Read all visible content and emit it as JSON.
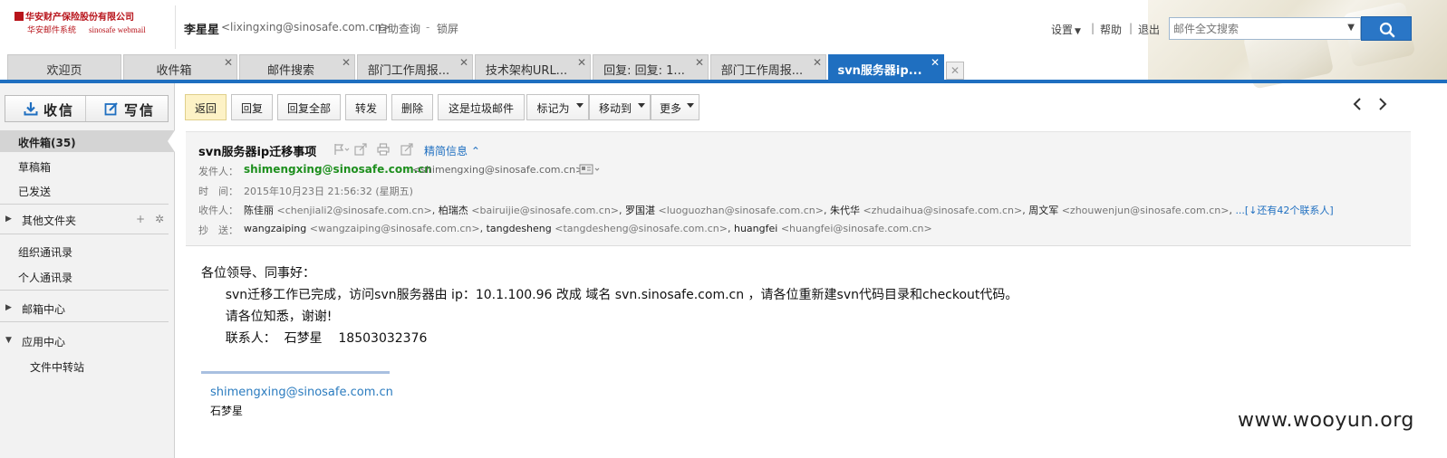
{
  "logo": {
    "company": "华安财产保险股份有限公司",
    "product_cn": "华安邮件系统",
    "product_en": "sinosafe webmail"
  },
  "header": {
    "user_name": "李星星",
    "user_email": "<lixingxing@sinosafe.com.cn>",
    "self_query": "自助查询",
    "separator": "-",
    "lock_screen": "锁屏",
    "settings": "设置",
    "help": "帮助",
    "logout": "退出",
    "sep": "|",
    "search_placeholder": "邮件全文搜索"
  },
  "tabs": [
    {
      "label": "欢迎页",
      "closable": false,
      "active": false
    },
    {
      "label": "收件箱",
      "closable": true,
      "active": false
    },
    {
      "label": "邮件搜索",
      "closable": true,
      "active": false
    },
    {
      "label": "部门工作周报...",
      "closable": true,
      "active": false
    },
    {
      "label": "技术架构URL...",
      "closable": true,
      "active": false
    },
    {
      "label": "回复: 回复: 1...",
      "closable": true,
      "active": false
    },
    {
      "label": "部门工作周报...",
      "closable": true,
      "active": false
    },
    {
      "label": "svn服务器ip...",
      "closable": true,
      "active": true
    }
  ],
  "sidebar": {
    "receive": "收信",
    "write": "写信",
    "items": [
      {
        "label": "收件箱(35)"
      },
      {
        "label": "草稿箱"
      },
      {
        "label": "已发送"
      },
      {
        "label": "其他文件夹"
      },
      {
        "label": "组织通讯录"
      },
      {
        "label": "个人通讯录"
      },
      {
        "label": "邮箱中心"
      },
      {
        "label": "应用中心"
      },
      {
        "label": "文件中转站"
      }
    ]
  },
  "toolbar": {
    "back": "返回",
    "reply": "回复",
    "reply_all": "回复全部",
    "forward": "转发",
    "delete": "删除",
    "spam": "这是垃圾邮件",
    "mark_as": "标记为",
    "move_to": "移动到",
    "more": "更多",
    "prev": "‹",
    "next": "›"
  },
  "mail": {
    "subject": "svn服务器ip迁移事项",
    "detail_link": "精简信息",
    "from_label": "发件人：",
    "sender_name": "shimengxing@sinosafe.com.cn",
    "sender_addr": "<shimengxing@sinosafe.com.cn>",
    "time_label": "时　间：",
    "time": "2015年10月23日 21:56:32 (星期五)",
    "to_label": "收件人：",
    "recipients": [
      {
        "name": "陈佳丽",
        "addr": "<chenjiali2@sinosafe.com.cn>"
      },
      {
        "name": "柏瑞杰",
        "addr": "<bairuijie@sinosafe.com.cn>"
      },
      {
        "name": "罗国湛",
        "addr": "<luoguozhan@sinosafe.com.cn>"
      },
      {
        "name": "朱代华",
        "addr": "<zhudaihua@sinosafe.com.cn>"
      },
      {
        "name": "周文军",
        "addr": "<zhouwenjun@sinosafe.com.cn>"
      }
    ],
    "recipients_more": "...[↓还有42个联系人]",
    "cc_label": "抄　送：",
    "cc": [
      {
        "name": "wangzaiping",
        "addr": "<wangzaiping@sinosafe.com.cn>"
      },
      {
        "name": "tangdesheng",
        "addr": "<tangdesheng@sinosafe.com.cn>"
      },
      {
        "name": "huangfei",
        "addr": "<huangfei@sinosafe.com.cn>"
      }
    ],
    "body": [
      "各位领导、同事好：",
      "      svn迁移工作已完成，访问svn服务器由 ip：10.1.100.96 改成 域名 svn.sinosafe.com.cn ，请各位重新建svn代码目录和checkout代码。",
      "      请各位知悉，谢谢!",
      "      联系人：  石梦星    18503032376"
    ],
    "signature_email": "shimengxing@sinosafe.com.cn",
    "signature_name": "石梦星"
  },
  "watermark": "www.wooyun.org",
  "colors": {
    "accent": "#1f6fc0",
    "sender": "#1e8f1e",
    "back_button": "#fdf2c6"
  }
}
